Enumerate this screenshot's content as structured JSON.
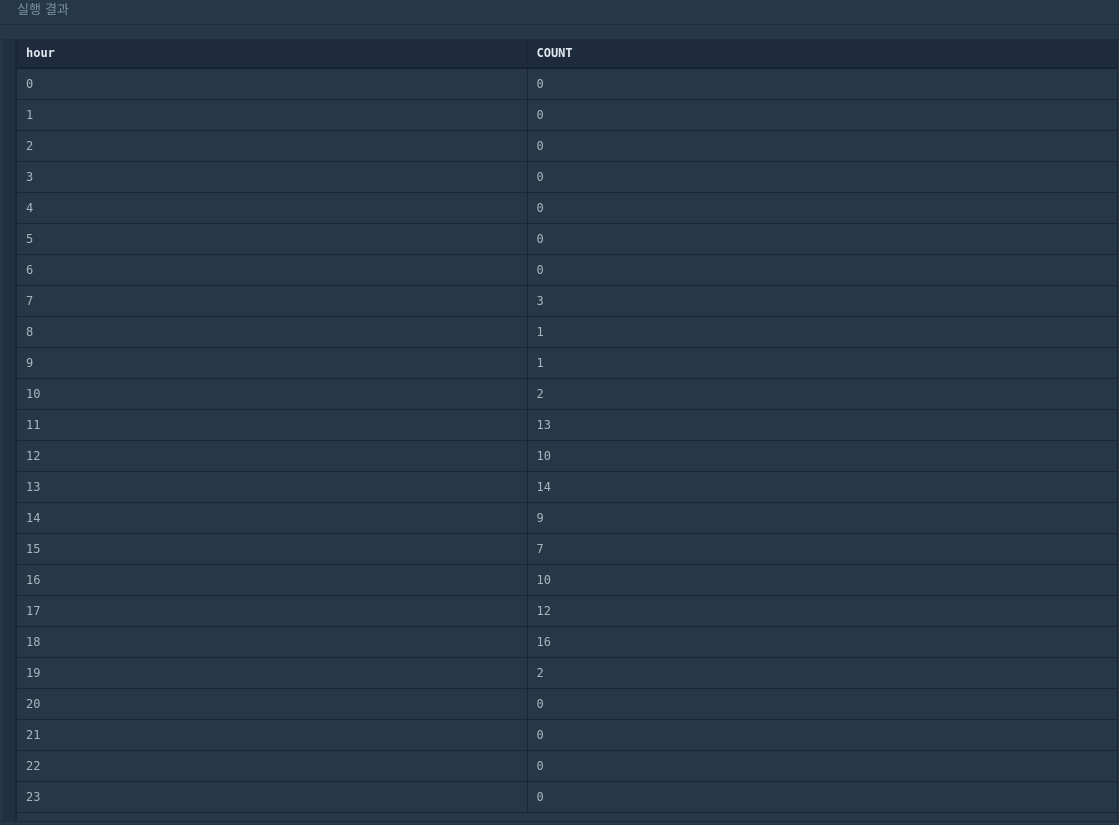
{
  "panel": {
    "title": "실행 결과"
  },
  "table": {
    "columns": [
      "hour",
      "COUNT"
    ],
    "rows": [
      [
        "0",
        "0"
      ],
      [
        "1",
        "0"
      ],
      [
        "2",
        "0"
      ],
      [
        "3",
        "0"
      ],
      [
        "4",
        "0"
      ],
      [
        "5",
        "0"
      ],
      [
        "6",
        "0"
      ],
      [
        "7",
        "3"
      ],
      [
        "8",
        "1"
      ],
      [
        "9",
        "1"
      ],
      [
        "10",
        "2"
      ],
      [
        "11",
        "13"
      ],
      [
        "12",
        "10"
      ],
      [
        "13",
        "14"
      ],
      [
        "14",
        "9"
      ],
      [
        "15",
        "7"
      ],
      [
        "16",
        "10"
      ],
      [
        "17",
        "12"
      ],
      [
        "18",
        "16"
      ],
      [
        "19",
        "2"
      ],
      [
        "20",
        "0"
      ],
      [
        "21",
        "0"
      ],
      [
        "22",
        "0"
      ],
      [
        "23",
        "0"
      ]
    ]
  },
  "colors": {
    "background": "#263747",
    "header_background": "#1e2b3c",
    "header_text": "#e0e7ee",
    "cell_text": "#aab4bf",
    "title_text": "#78909c",
    "grid_line": "#1a2735"
  }
}
